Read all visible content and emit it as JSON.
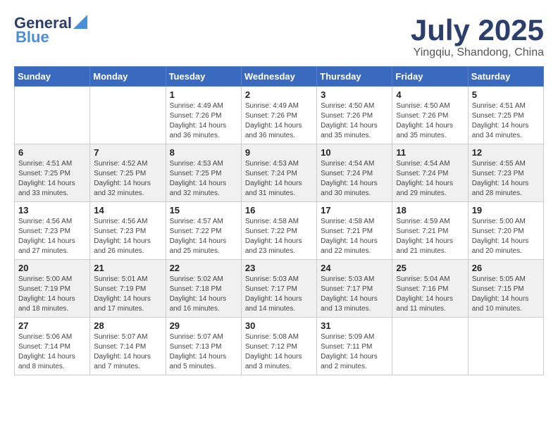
{
  "header": {
    "logo_line1": "General",
    "logo_line2": "Blue",
    "month": "July 2025",
    "location": "Yingqiu, Shandong, China"
  },
  "weekdays": [
    "Sunday",
    "Monday",
    "Tuesday",
    "Wednesday",
    "Thursday",
    "Friday",
    "Saturday"
  ],
  "weeks": [
    [
      {
        "day": "",
        "info": ""
      },
      {
        "day": "",
        "info": ""
      },
      {
        "day": "1",
        "info": "Sunrise: 4:49 AM\nSunset: 7:26 PM\nDaylight: 14 hours and 36 minutes."
      },
      {
        "day": "2",
        "info": "Sunrise: 4:49 AM\nSunset: 7:26 PM\nDaylight: 14 hours and 36 minutes."
      },
      {
        "day": "3",
        "info": "Sunrise: 4:50 AM\nSunset: 7:26 PM\nDaylight: 14 hours and 35 minutes."
      },
      {
        "day": "4",
        "info": "Sunrise: 4:50 AM\nSunset: 7:26 PM\nDaylight: 14 hours and 35 minutes."
      },
      {
        "day": "5",
        "info": "Sunrise: 4:51 AM\nSunset: 7:25 PM\nDaylight: 14 hours and 34 minutes."
      }
    ],
    [
      {
        "day": "6",
        "info": "Sunrise: 4:51 AM\nSunset: 7:25 PM\nDaylight: 14 hours and 33 minutes."
      },
      {
        "day": "7",
        "info": "Sunrise: 4:52 AM\nSunset: 7:25 PM\nDaylight: 14 hours and 32 minutes."
      },
      {
        "day": "8",
        "info": "Sunrise: 4:53 AM\nSunset: 7:25 PM\nDaylight: 14 hours and 32 minutes."
      },
      {
        "day": "9",
        "info": "Sunrise: 4:53 AM\nSunset: 7:24 PM\nDaylight: 14 hours and 31 minutes."
      },
      {
        "day": "10",
        "info": "Sunrise: 4:54 AM\nSunset: 7:24 PM\nDaylight: 14 hours and 30 minutes."
      },
      {
        "day": "11",
        "info": "Sunrise: 4:54 AM\nSunset: 7:24 PM\nDaylight: 14 hours and 29 minutes."
      },
      {
        "day": "12",
        "info": "Sunrise: 4:55 AM\nSunset: 7:23 PM\nDaylight: 14 hours and 28 minutes."
      }
    ],
    [
      {
        "day": "13",
        "info": "Sunrise: 4:56 AM\nSunset: 7:23 PM\nDaylight: 14 hours and 27 minutes."
      },
      {
        "day": "14",
        "info": "Sunrise: 4:56 AM\nSunset: 7:23 PM\nDaylight: 14 hours and 26 minutes."
      },
      {
        "day": "15",
        "info": "Sunrise: 4:57 AM\nSunset: 7:22 PM\nDaylight: 14 hours and 25 minutes."
      },
      {
        "day": "16",
        "info": "Sunrise: 4:58 AM\nSunset: 7:22 PM\nDaylight: 14 hours and 23 minutes."
      },
      {
        "day": "17",
        "info": "Sunrise: 4:58 AM\nSunset: 7:21 PM\nDaylight: 14 hours and 22 minutes."
      },
      {
        "day": "18",
        "info": "Sunrise: 4:59 AM\nSunset: 7:21 PM\nDaylight: 14 hours and 21 minutes."
      },
      {
        "day": "19",
        "info": "Sunrise: 5:00 AM\nSunset: 7:20 PM\nDaylight: 14 hours and 20 minutes."
      }
    ],
    [
      {
        "day": "20",
        "info": "Sunrise: 5:00 AM\nSunset: 7:19 PM\nDaylight: 14 hours and 18 minutes."
      },
      {
        "day": "21",
        "info": "Sunrise: 5:01 AM\nSunset: 7:19 PM\nDaylight: 14 hours and 17 minutes."
      },
      {
        "day": "22",
        "info": "Sunrise: 5:02 AM\nSunset: 7:18 PM\nDaylight: 14 hours and 16 minutes."
      },
      {
        "day": "23",
        "info": "Sunrise: 5:03 AM\nSunset: 7:17 PM\nDaylight: 14 hours and 14 minutes."
      },
      {
        "day": "24",
        "info": "Sunrise: 5:03 AM\nSunset: 7:17 PM\nDaylight: 14 hours and 13 minutes."
      },
      {
        "day": "25",
        "info": "Sunrise: 5:04 AM\nSunset: 7:16 PM\nDaylight: 14 hours and 11 minutes."
      },
      {
        "day": "26",
        "info": "Sunrise: 5:05 AM\nSunset: 7:15 PM\nDaylight: 14 hours and 10 minutes."
      }
    ],
    [
      {
        "day": "27",
        "info": "Sunrise: 5:06 AM\nSunset: 7:14 PM\nDaylight: 14 hours and 8 minutes."
      },
      {
        "day": "28",
        "info": "Sunrise: 5:07 AM\nSunset: 7:14 PM\nDaylight: 14 hours and 7 minutes."
      },
      {
        "day": "29",
        "info": "Sunrise: 5:07 AM\nSunset: 7:13 PM\nDaylight: 14 hours and 5 minutes."
      },
      {
        "day": "30",
        "info": "Sunrise: 5:08 AM\nSunset: 7:12 PM\nDaylight: 14 hours and 3 minutes."
      },
      {
        "day": "31",
        "info": "Sunrise: 5:09 AM\nSunset: 7:11 PM\nDaylight: 14 hours and 2 minutes."
      },
      {
        "day": "",
        "info": ""
      },
      {
        "day": "",
        "info": ""
      }
    ]
  ]
}
